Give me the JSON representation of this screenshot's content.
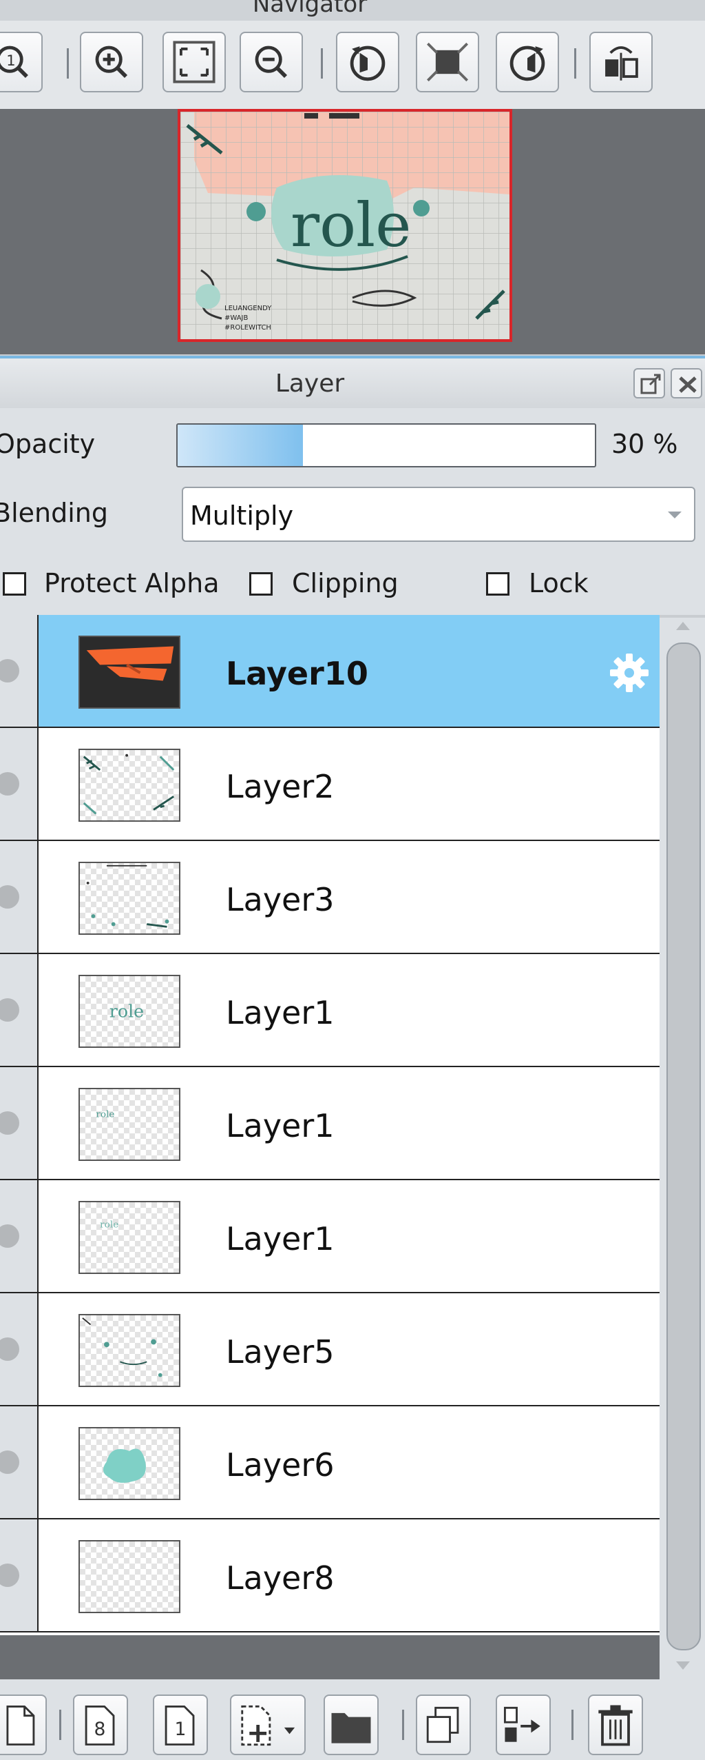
{
  "navigator": {
    "title": "Navigator",
    "toolbar": [
      {
        "name": "zoom-actual-size-icon"
      },
      {
        "name": "zoom-in-icon"
      },
      {
        "name": "fit-to-window-icon"
      },
      {
        "name": "zoom-out-icon"
      },
      {
        "name": "rotate-left-icon"
      },
      {
        "name": "reset-rotation-icon"
      },
      {
        "name": "rotate-right-icon"
      },
      {
        "name": "flip-horizontal-icon"
      }
    ],
    "preview_text": "role",
    "preview_caption_lines": [
      "LEUANGENDY",
      "#WAJB",
      "#ROLEWITCH"
    ]
  },
  "layer_panel": {
    "title": "Layer",
    "opacity_label": "Opacity",
    "opacity_value": "30 %",
    "opacity_fraction": 0.3,
    "blending_label": "Blending",
    "blending_value": "Multiply",
    "checkboxes": [
      {
        "label": "Protect Alpha",
        "checked": false
      },
      {
        "label": "Clipping",
        "checked": false
      },
      {
        "label": "Lock",
        "checked": false
      }
    ],
    "layers": [
      {
        "name": "Layer10",
        "selected": true,
        "thumb": "orange-shape"
      },
      {
        "name": "Layer2",
        "selected": false,
        "thumb": "frame-leaves"
      },
      {
        "name": "Layer3",
        "selected": false,
        "thumb": "frame-dots"
      },
      {
        "name": "Layer1",
        "selected": false,
        "thumb": "role-text"
      },
      {
        "name": "Layer1",
        "selected": false,
        "thumb": "small-text"
      },
      {
        "name": "Layer1",
        "selected": false,
        "thumb": "small-text-2"
      },
      {
        "name": "Layer5",
        "selected": false,
        "thumb": "scatter"
      },
      {
        "name": "Layer6",
        "selected": false,
        "thumb": "blob"
      },
      {
        "name": "Layer8",
        "selected": false,
        "thumb": "empty"
      }
    ],
    "bottom_toolbar": [
      {
        "name": "new-layer-icon"
      },
      {
        "name": "new-8bit-layer-icon",
        "label": "8"
      },
      {
        "name": "new-1bit-layer-icon",
        "label": "1"
      },
      {
        "name": "add-layer-menu-icon"
      },
      {
        "name": "new-folder-icon"
      },
      {
        "name": "duplicate-layer-icon"
      },
      {
        "name": "merge-down-icon"
      },
      {
        "name": "delete-layer-icon"
      }
    ]
  },
  "colors": {
    "selected_row": "#82cdf5",
    "accent_blue": "#7fc0ee",
    "navigator_frame": "#d8262a",
    "dark_gray": "#6b6e72"
  }
}
